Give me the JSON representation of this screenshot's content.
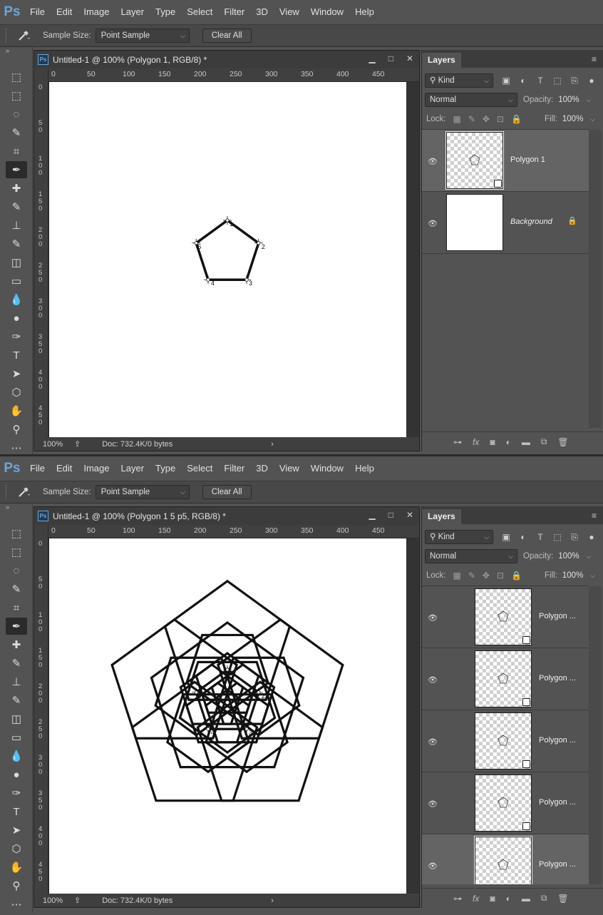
{
  "screens": [
    {
      "app": {
        "logo": "Ps",
        "menu": [
          "File",
          "Edit",
          "Image",
          "Layer",
          "Type",
          "Select",
          "Filter",
          "3D",
          "View",
          "Window",
          "Help"
        ]
      },
      "options": {
        "sample_size_label": "Sample Size:",
        "sample_size_value": "Point Sample",
        "clear_all": "Clear All"
      },
      "document": {
        "title": "Untitled-1 @ 100% (Polygon 1, RGB/8) *",
        "zoom": "100%",
        "doc_info": "Doc: 732.4K/0 bytes"
      },
      "ruler": {
        "h": [
          "0",
          "50",
          "100",
          "150",
          "200",
          "250",
          "300",
          "350",
          "400",
          "450"
        ],
        "v": [
          "0",
          "5 0",
          "1 0 0",
          "1 5 0",
          "2 0 0",
          "2 5 0",
          "3 0 0",
          "3 5 0",
          "4 0 0",
          "4 5 0"
        ]
      },
      "vertex_labels": [
        "1",
        "2",
        "3",
        "4",
        "5"
      ],
      "layers": {
        "tab": "Layers",
        "kind": "Kind",
        "blend": "Normal",
        "opacity_label": "Opacity:",
        "opacity": "100%",
        "lock_label": "Lock:",
        "fill_label": "Fill:",
        "fill": "100%",
        "items": [
          {
            "name": "Polygon 1",
            "selected": true,
            "thumb": "transparent"
          },
          {
            "name": "Background",
            "selected": false,
            "thumb": "white",
            "locked": true
          }
        ]
      }
    },
    {
      "app": {
        "logo": "Ps",
        "menu": [
          "File",
          "Edit",
          "Image",
          "Layer",
          "Type",
          "Select",
          "Filter",
          "3D",
          "View",
          "Window",
          "Help"
        ]
      },
      "options": {
        "sample_size_label": "Sample Size:",
        "sample_size_value": "Point Sample",
        "clear_all": "Clear All"
      },
      "document": {
        "title": "Untitled-1 @ 100% (Polygon 1 5 p5, RGB/8) *",
        "zoom": "100%",
        "doc_info": "Doc: 732.4K/0 bytes"
      },
      "ruler": {
        "h": [
          "0",
          "50",
          "100",
          "150",
          "200",
          "250",
          "300",
          "350",
          "400",
          "450"
        ],
        "v": [
          "0",
          "5 0",
          "1 0 0",
          "1 5 0",
          "2 0 0",
          "2 5 0",
          "3 0 0",
          "3 5 0",
          "4 0 0",
          "4 5 0"
        ]
      },
      "vertex_labels": [
        "1",
        "2",
        "3",
        "4",
        "5"
      ],
      "layers": {
        "tab": "Layers",
        "kind": "Kind",
        "blend": "Normal",
        "opacity_label": "Opacity:",
        "opacity": "100%",
        "lock_label": "Lock:",
        "fill_label": "Fill:",
        "fill": "100%",
        "items": [
          {
            "name": "Polygon ...",
            "selected": false,
            "thumb": "transparent"
          },
          {
            "name": "Polygon ...",
            "selected": false,
            "thumb": "transparent"
          },
          {
            "name": "Polygon ...",
            "selected": false,
            "thumb": "transparent"
          },
          {
            "name": "Polygon ...",
            "selected": false,
            "thumb": "transparent"
          },
          {
            "name": "Polygon ...",
            "selected": true,
            "thumb": "transparent"
          }
        ]
      }
    }
  ],
  "icons": {
    "tools": [
      "move-artboard-icon",
      "rectangular-marquee-icon",
      "lasso-icon",
      "quick-selection-icon",
      "crop-icon",
      "eyedropper-icon",
      "healing-brush-icon",
      "brush-icon",
      "clone-stamp-icon",
      "history-brush-icon",
      "eraser-icon",
      "gradient-icon",
      "blur-icon",
      "dodge-icon",
      "pen-icon",
      "type-icon",
      "path-selection-icon",
      "polygon-tool-icon",
      "hand-icon",
      "zoom-icon",
      "more-tools-icon"
    ],
    "layer_footer": [
      "link-layers-icon",
      "fx-icon",
      "add-mask-icon",
      "adjustment-layer-icon",
      "new-group-icon",
      "new-layer-icon",
      "delete-layer-icon"
    ]
  }
}
